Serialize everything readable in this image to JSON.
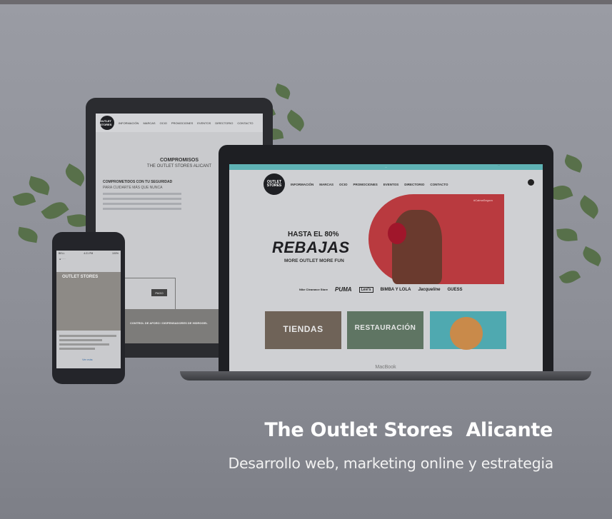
{
  "tablet": {
    "nav": [
      "INFORMACIÓN",
      "MARCAS",
      "OCIO",
      "PROMOCIONES",
      "EVENTOS",
      "DIRECTORIO",
      "CONTACTO"
    ],
    "logo": "OUTLET STORES",
    "title": "COMPROMISOS",
    "subtitle": "THE OUTLET STORES ALICANT",
    "heading": "COMPROMETIDOS CON TU SEGURIDAD",
    "subheading": "PARA CUIDARTE MÁS QUE NUNCA",
    "button": "PAGO",
    "footer": "CONTROL DE AFORO / DISPENSADORES DE HIDROGEL"
  },
  "laptop": {
    "top_strip": "...",
    "top_right": "...",
    "logo": "OUTLET STORES",
    "nav": [
      "INFORMACIÓN",
      "MARCAS",
      "OCIO",
      "PROMOCIONES",
      "EVENTOS",
      "DIRECTORIO",
      "CONTACTO"
    ],
    "hero_line1": "HASTA EL 80%",
    "hero_line2": "REBAJAS",
    "hero_line3": "MORE OUTLET  MORE FUN",
    "hero_tag": "#CalmaSegura",
    "brands": [
      "Nike Clearance Store",
      "PUMA",
      "Levi's",
      "BIMBA Y LOLA",
      "Jacqueline",
      "GUESS"
    ],
    "tiles": [
      "TIENDAS",
      "RESTAURACIÓN",
      ""
    ],
    "base_label": "MacBook"
  },
  "phone": {
    "status_left": "BELL",
    "status_center": "4:21 PM",
    "status_right": "100%",
    "image_text": "OUTLET STORES",
    "link": "Ver más"
  },
  "caption": {
    "title": "The Outlet Stores  Alicante",
    "subtitle": "Desarrollo web, marketing online y estrategia"
  }
}
